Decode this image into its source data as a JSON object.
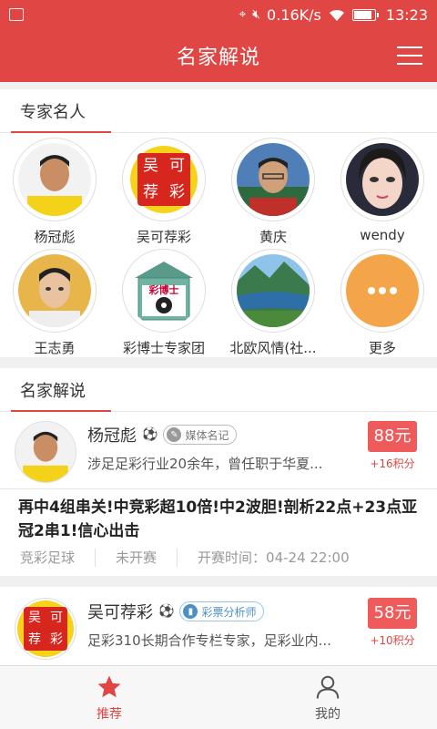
{
  "status_bar": {
    "speed": "0.16K/s",
    "time": "13:23",
    "battery_level": 0.8
  },
  "header": {
    "title": "名家解说",
    "menu_icon": "hamburger-menu-icon"
  },
  "experts_section": {
    "title": "专家名人",
    "experts": [
      {
        "name": "杨冠彪"
      },
      {
        "name": "吴可荐彩",
        "logo_chars": [
          "吴",
          "可",
          "荐",
          "彩"
        ]
      },
      {
        "name": "黄庆"
      },
      {
        "name": "wendy"
      },
      {
        "name": "王志勇"
      },
      {
        "name": "彩博士专家团",
        "logo_text": "彩博士"
      },
      {
        "name": "北欧风情(社..."
      },
      {
        "name": "更多",
        "icon": "more-dots-icon"
      }
    ]
  },
  "commentary_section": {
    "title": "名家解说",
    "cards": [
      {
        "name": "杨冠彪",
        "badge": "媒体名记",
        "desc": "涉足足彩行业20余年，曾任职于华夏...",
        "price": "88元",
        "points": "+16积分",
        "headline": "再中4组串关!中竞彩超10倍!中2波胆!剖析22点+23点亚冠2串1!信心出击",
        "meta": {
          "category": "竞彩足球",
          "state": "未开赛",
          "kickoff": "开赛时间：04-24 22:00"
        }
      },
      {
        "name": "吴可荐彩",
        "badge": "彩票分析师",
        "desc": "足彩310长期合作专栏专家，足彩业内...",
        "price": "58元",
        "points": "+10积分"
      }
    ]
  },
  "tabbar": {
    "tabs": [
      {
        "label": "推荐",
        "icon": "star-icon",
        "active": true
      },
      {
        "label": "我的",
        "icon": "person-icon",
        "active": false
      }
    ]
  },
  "colors": {
    "brand": "#e04644",
    "price": "#ef5a5a",
    "badge_blue": "#4a90c8"
  }
}
